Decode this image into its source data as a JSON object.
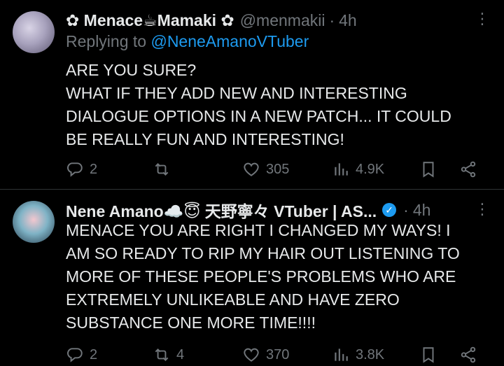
{
  "tweets": [
    {
      "name": "✿ Menace☕Mamaki ✿",
      "handle": "@menmakii",
      "time": "4h",
      "replying_prefix": "Replying to",
      "replying_to": "@NeneAmanoVTuber",
      "lines": [
        "ARE YOU SURE?",
        "WHAT IF THEY ADD NEW AND INTERESTING",
        "DIALOGUE OPTIONS IN A NEW PATCH... IT COULD",
        "BE REALLY FUN AND INTERESTING!"
      ],
      "replies": "2",
      "reposts": "",
      "likes": "305",
      "views": "4.9K"
    },
    {
      "name": "Nene Amano☁️😇 天野寧々 VTuber | AS...",
      "verified": true,
      "time": "4h",
      "lines": [
        "MENACE YOU ARE RIGHT I CHANGED MY WAYS! I",
        "AM SO READY TO RIP MY HAIR OUT LISTENING TO",
        "MORE OF THESE PEOPLE'S PROBLEMS WHO ARE",
        "EXTREMELY UNLIKEABLE AND HAVE ZERO",
        "SUBSTANCE ONE MORE TIME!!!!"
      ],
      "replies": "2",
      "reposts": "4",
      "likes": "370",
      "views": "3.8K"
    }
  ],
  "icons": {
    "reply": "reply-icon",
    "repost": "repost-icon",
    "like": "heart-icon",
    "views": "views-icon",
    "bookmark": "bookmark-icon",
    "share": "share-icon",
    "more": "more-icon"
  },
  "colors": {
    "background": "#000000",
    "text": "#e7e9ea",
    "muted": "#71767b",
    "accent": "#1d9bf0"
  },
  "symbols": {
    "more": "⋮",
    "dot": "·",
    "verified_check": "✓"
  }
}
